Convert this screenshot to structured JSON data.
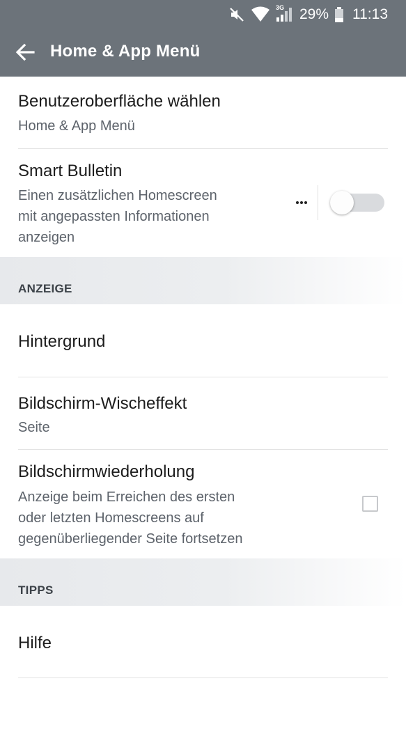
{
  "status_bar": {
    "icons": [
      "mute-icon",
      "wifi-icon",
      "signal-icon",
      "battery-icon"
    ],
    "network_type": "3G",
    "battery": "29%",
    "time": "11:13"
  },
  "app_bar": {
    "back_icon": "arrow-left-icon",
    "title": "Home & App Menü"
  },
  "settings": {
    "ui_choice": {
      "title": "Benutzeroberfläche wählen",
      "value": "Home & App Menü"
    },
    "smart_bulletin": {
      "title": "Smart Bulletin",
      "summary_lines": [
        "Einen zusätzlichen Homescreen",
        "mit angepassten Informationen",
        "anzeigen"
      ],
      "enabled": false
    },
    "section_display": "ANZEIGE",
    "wallpaper": {
      "title": "Hintergrund"
    },
    "swipe_effect": {
      "title": "Bildschirm-Wischeffekt",
      "value": "Seite"
    },
    "screen_loop": {
      "title": "Bildschirmwiederholung",
      "summary_lines": [
        "Anzeige beim Erreichen des ersten",
        "oder letzten Homescreens auf",
        "gegenüberliegender Seite fortsetzen"
      ],
      "checked": false
    },
    "section_tips": "TIPPS",
    "help": {
      "title": "Hilfe"
    }
  },
  "colors": {
    "app_bar": "#6c737a",
    "section_header_bg": "#e7e9ec",
    "toggle_track": "#d9dbde"
  }
}
